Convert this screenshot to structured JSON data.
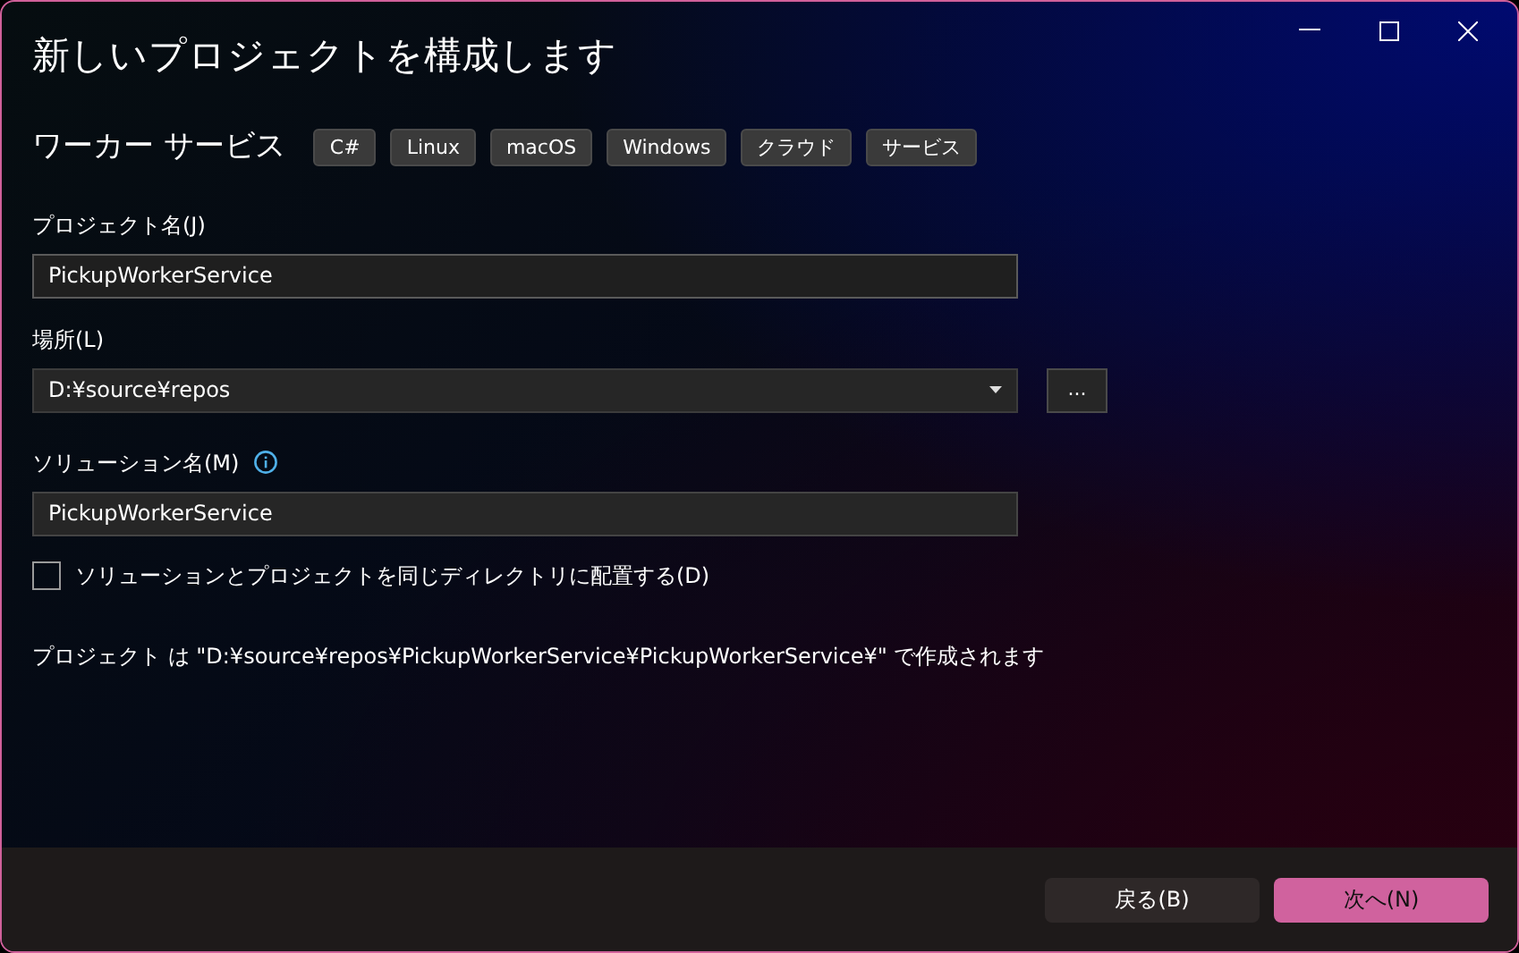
{
  "window": {
    "title": "新しいプロジェクトを構成します"
  },
  "template": {
    "name": "ワーカー サービス",
    "tags": [
      "C#",
      "Linux",
      "macOS",
      "Windows",
      "クラウド",
      "サービス"
    ]
  },
  "project_name": {
    "label": "プロジェクト名(J)",
    "value": "PickupWorkerService"
  },
  "location": {
    "label": "場所(L)",
    "value": "D:¥source¥repos",
    "browse": "..."
  },
  "solution_name": {
    "label": "ソリューション名(M)",
    "value": "PickupWorkerService"
  },
  "same_directory": {
    "label": "ソリューションとプロジェクトを同じディレクトリに配置する(D)",
    "checked": false
  },
  "path_note": "プロジェクト は \"D:¥source¥repos¥PickupWorkerService¥PickupWorkerService¥\" で作成されます",
  "buttons": [
    {
      "label": "戻る(B)",
      "kind": "secondary"
    },
    {
      "label": "次へ(N)",
      "kind": "primary"
    }
  ]
}
